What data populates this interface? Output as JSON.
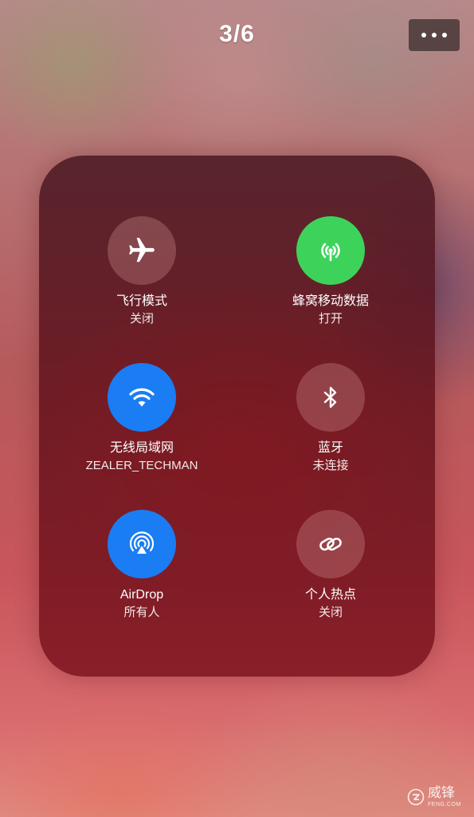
{
  "header": {
    "page_counter": "3/6",
    "more_button_icon": "ellipsis-icon"
  },
  "tiles": [
    {
      "label": "飞行模式",
      "status": "关闭",
      "icon": "airplane-icon",
      "state": "off"
    },
    {
      "label": "蜂窝移动数据",
      "status": "打开",
      "icon": "cellular-antenna-icon",
      "state": "on",
      "color": "#3dd35b"
    },
    {
      "label": "无线局域网",
      "status": "ZEALER_TECHMAN",
      "icon": "wifi-icon",
      "state": "on",
      "color": "#1a7df3"
    },
    {
      "label": "蓝牙",
      "status": "未连接",
      "icon": "bluetooth-icon",
      "state": "off"
    },
    {
      "label": "AirDrop",
      "status": "所有人",
      "icon": "airdrop-icon",
      "state": "on",
      "color": "#1a7df3"
    },
    {
      "label": "个人热点",
      "status": "关闭",
      "icon": "hotspot-link-icon",
      "state": "off"
    }
  ],
  "watermark": {
    "brand_cn": "威锋",
    "brand_en": "FENG.COM"
  }
}
